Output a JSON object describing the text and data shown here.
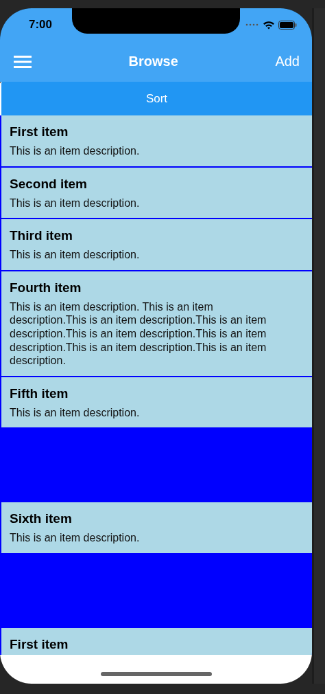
{
  "status_bar": {
    "time": "7:00"
  },
  "nav_bar": {
    "title": "Browse",
    "action": "Add"
  },
  "sort_button": {
    "label": "Sort"
  },
  "items": [
    {
      "kind": "item",
      "title": "First item",
      "description": "This is an item description."
    },
    {
      "kind": "item",
      "title": "Second item",
      "description": "This is an item description."
    },
    {
      "kind": "item",
      "title": "Third item",
      "description": "This is an item description."
    },
    {
      "kind": "item",
      "title": "Fourth item",
      "description": "This is an item description. This is an item description.This is an item description.This is an item description.This is an item description.This is an item description.This is an item description.This is an item description."
    },
    {
      "kind": "item",
      "title": "Fifth item",
      "description": "This is an item description."
    },
    {
      "kind": "spacer"
    },
    {
      "kind": "item",
      "title": "Sixth item",
      "description": "This is an item description."
    },
    {
      "kind": "spacer"
    },
    {
      "kind": "item",
      "title": "First item"
    }
  ]
}
